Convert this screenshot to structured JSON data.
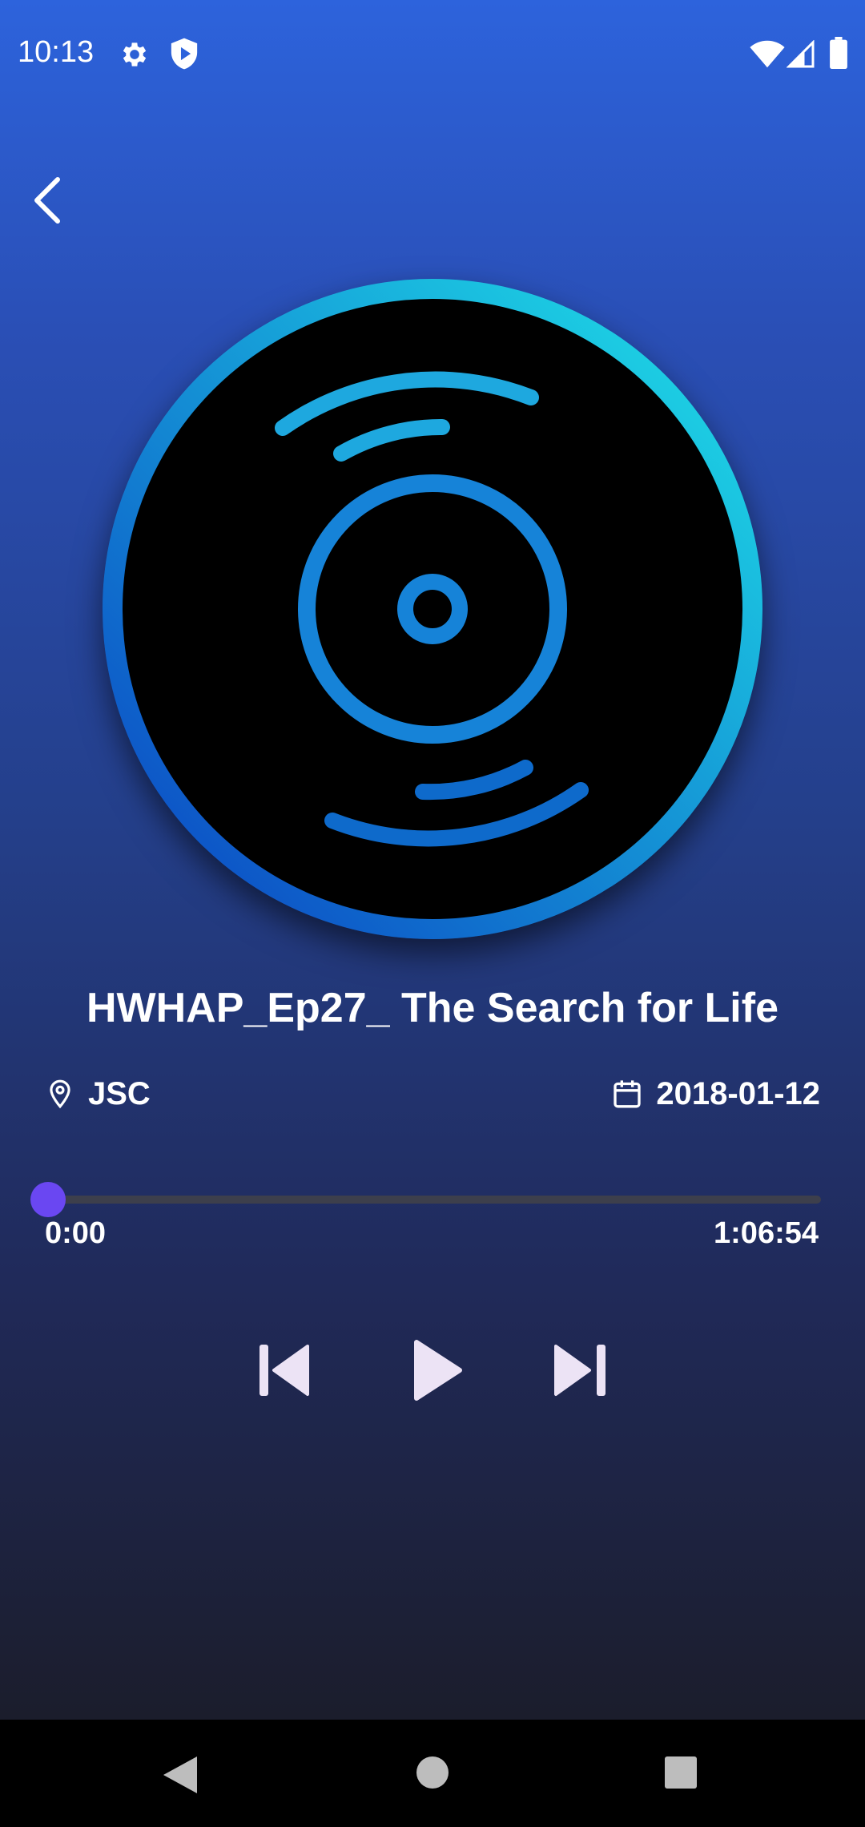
{
  "status_bar": {
    "time": "10:13",
    "icons": [
      "gear-icon",
      "shield-play-icon",
      "wifi-icon",
      "signal-icon",
      "battery-icon"
    ]
  },
  "header": {
    "back_icon": "chevron-left-icon"
  },
  "artwork": {
    "icon": "vinyl-disc-icon",
    "ring_colors": [
      "#1fe4e8",
      "#0a3fc2"
    ],
    "groove_color": "#1683d8"
  },
  "episode": {
    "title": "HWHAP_Ep27_ The Search for Life",
    "location": "JSC",
    "location_icon": "map-pin-icon",
    "date": "2018-01-12",
    "date_icon": "calendar-icon"
  },
  "player": {
    "current_time": "0:00",
    "total_time": "1:06:54",
    "progress": 0.0,
    "accent_color": "#6a47f2",
    "controls": {
      "prev_icon": "skip-previous-icon",
      "play_icon": "play-icon",
      "next_icon": "skip-next-icon"
    }
  },
  "nav_bar": {
    "icons": [
      "back-triangle-icon",
      "home-circle-icon",
      "recents-square-icon"
    ]
  }
}
